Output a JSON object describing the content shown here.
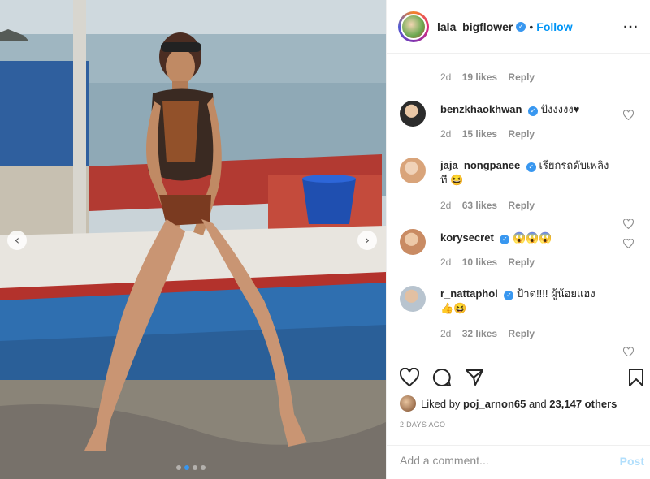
{
  "post": {
    "username": "lala_bigflower",
    "verified_glyph": "✓",
    "separator": "•",
    "follow_label": "Follow",
    "more_glyph": "···"
  },
  "photo": {
    "prev_glyph": "‹",
    "next_glyph": "›",
    "slide_count": 4,
    "active_slide": 2
  },
  "comments": {
    "partial_meta": {
      "age": "2d",
      "likes": "19 likes",
      "reply": "Reply"
    },
    "items": [
      {
        "user": "benzkhaokhwan",
        "text": "ปังงงงง♥",
        "text2": "",
        "age": "2d",
        "likes": "15 likes",
        "reply": "Reply",
        "avatar_color": "#2b2b2b"
      },
      {
        "user": "jaja_nongpanee",
        "text": "เรียกรถดับเพลิง",
        "text2": "ที 😆",
        "age": "2d",
        "likes": "63 likes",
        "reply": "Reply",
        "avatar_color": "#d9a47a"
      },
      {
        "user": "korysecret",
        "text": "😱😱😱",
        "text2": "",
        "age": "2d",
        "likes": "10 likes",
        "reply": "Reply",
        "avatar_color": "#c98b63"
      },
      {
        "user": "r_nattaphol",
        "text": "ป้าด!!!! ผู้น้อยแฮง",
        "text2": "👍😆",
        "age": "2d",
        "likes": "32 likes",
        "reply": "Reply",
        "avatar_color": "#b8c4cf"
      }
    ]
  },
  "actions": {
    "liked_by_prefix": "Liked by",
    "liked_by_user": "poj_arnon65",
    "liked_by_and": "and",
    "liked_by_count": "23,147 others",
    "date": "2 DAYS AGO",
    "icons": [
      "heart-icon",
      "comment-icon",
      "share-icon",
      "bookmark-icon"
    ]
  },
  "composer": {
    "placeholder": "Add a comment...",
    "post_label": "Post"
  },
  "colors": {
    "accent": "#0095f6",
    "verified": "#3897f0",
    "muted": "#8e8e8e"
  }
}
